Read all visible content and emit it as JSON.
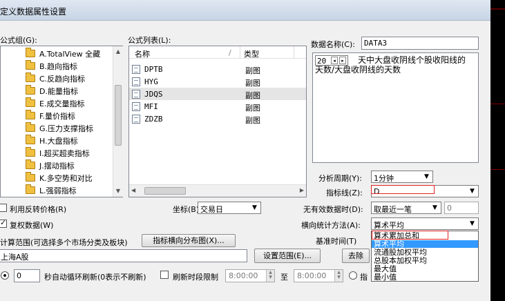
{
  "window": {
    "title": "定义数据属性设置"
  },
  "left_panel": {
    "label": "公式组(G):",
    "groups": [
      "A.TotalView 全藏",
      "B.趋向指标",
      "C.反趋向指标",
      "D.能量指标",
      "E.成交量指标",
      "F.量价指标",
      "G.压力支撑指标",
      "H.大盘指标",
      "I.超买超卖指标",
      "J.摆动指标",
      "K.多空势和对比",
      "L.强弱指标"
    ]
  },
  "formula_list": {
    "label": "公式列表(L):",
    "columns": {
      "name": "名称",
      "sep": "/",
      "type": "类型"
    },
    "rows": [
      {
        "name": "DPTB",
        "type": "副图"
      },
      {
        "name": "HYG",
        "type": "副图"
      },
      {
        "name": "JDQS",
        "type": "副图"
      },
      {
        "name": "MFI",
        "type": "副图"
      },
      {
        "name": "ZDZB",
        "type": "副图"
      }
    ]
  },
  "data_name": {
    "label": "数据名称(C):",
    "value": "DATA3"
  },
  "description": {
    "spin_value": "20",
    "text": "天中大盘收阴线个股收阳线的天数/大盘收阴线的天数"
  },
  "analysis_period": {
    "label": "分析周期(Y):",
    "value": "1分钟"
  },
  "indicator_line": {
    "label": "指标线(Z):",
    "value": "D"
  },
  "reverse_price": {
    "label": "利用反转价格(R)",
    "checked": false
  },
  "restore_data": {
    "label": "复权数据(W)",
    "checked": true
  },
  "coordinate": {
    "label": "坐标(B):",
    "value": "交易日"
  },
  "no_data": {
    "label": "无有效数据时(D):",
    "value": "取最近一笔",
    "extra_value": "0"
  },
  "horizontal_stat": {
    "label": "横向统计方法(A):",
    "value": "算术平均",
    "options": [
      "算术累加总和",
      "算术平均",
      "流通股加权平均",
      "总股本加权平均",
      "最大值",
      "最小值"
    ],
    "highlighted": "算术平均"
  },
  "base_time": {
    "label": "基准时间(T)"
  },
  "calc_range": {
    "label": "计算范围(可选择多个市场分类及板块)",
    "button": "指标横向分布图(X)...",
    "value": "上海A股"
  },
  "buttons": {
    "set_range": "设置范围(E)...",
    "remove": "去除"
  },
  "bottom": {
    "seconds_value": "0",
    "auto_refresh_label": "秒自动循环刷新(0表示不刷新)",
    "refresh_limit_label": "刷新时段限制",
    "time_from": "8:00:00",
    "to_label": "至",
    "time_to": "8:00:00",
    "specify_label": "指"
  },
  "colors": {
    "highlight": "#3399ff",
    "error": "#e02020",
    "titlebar": "#c7d5e6"
  }
}
